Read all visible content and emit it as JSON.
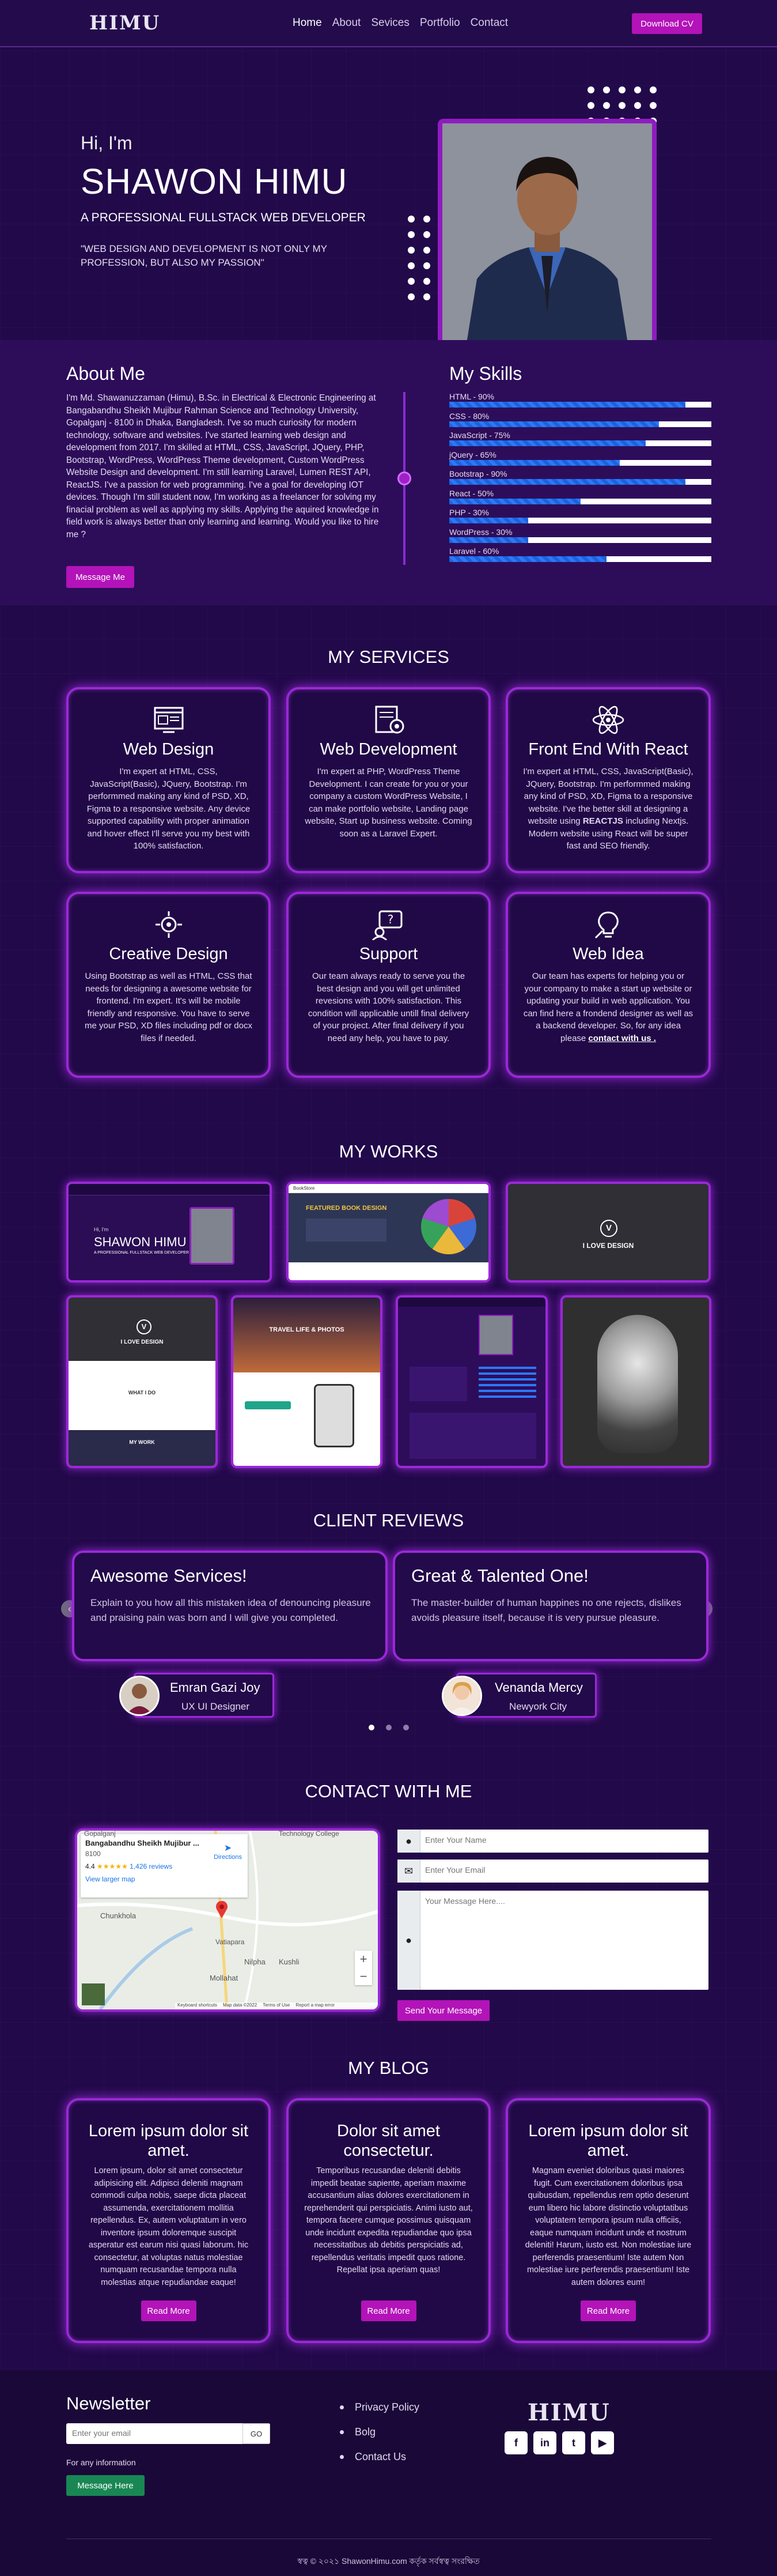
{
  "header": {
    "logo": "HIMU",
    "nav": [
      "Home",
      "About",
      "Sevices",
      "Portfolio",
      "Contact"
    ],
    "download_cv": "Download CV"
  },
  "hero": {
    "greeting": "Hi, I'm",
    "name": "SHAWON HIMU",
    "title": "A PROFESSIONAL FULLSTACK WEB DEVELOPER",
    "quote": "\"WEB DESIGN AND DEVELOPMENT IS NOT ONLY MY PROFESSION, BUT ALSO MY PASSION\""
  },
  "about": {
    "heading": "About Me",
    "text": "I'm Md. Shawanuzzaman (Himu), B.Sc. in Electrical & Electronic Engineering at Bangabandhu Sheikh Mujibur Rahman Science and Technology University, Gopalganj - 8100 in Dhaka, Bangladesh. I've so much curiosity for modern technology, software and websites. I've started learning web design and development from 2017. I'm skilled at HTML, CSS, JavaScript, JQuery, PHP, Bootstrap, WordPress, WordPress Theme development, Custom WordPress Website Design and development. I'm still learning Laravel, Lumen REST API, ReactJS. I've a passion for web programming. I've a goal for developing IOT devices. Though I'm still student now, I'm working as a freelancer for solving my finacial problem as well as applying my skills. Applying the aquired knowledge in field work is always better than only learning and learning. Would you like to hire me ?",
    "button": "Message Me"
  },
  "skills": {
    "heading": "My Skills",
    "items": [
      {
        "label": "HTML - 90%",
        "value": 90
      },
      {
        "label": "CSS - 80%",
        "value": 80
      },
      {
        "label": "JavaScript - 75%",
        "value": 75
      },
      {
        "label": "jQuery - 65%",
        "value": 65
      },
      {
        "label": "Bootstrap - 90%",
        "value": 90
      },
      {
        "label": "React - 50%",
        "value": 50
      },
      {
        "label": "PHP - 30%",
        "value": 30
      },
      {
        "label": "WordPress - 30%",
        "value": 30
      },
      {
        "label": "Laravel - 60%",
        "value": 60
      }
    ]
  },
  "services": {
    "heading": "MY SERVICES",
    "items": [
      {
        "icon": "web-design-icon",
        "title": "Web Design",
        "text": "I'm expert at HTML, CSS, JavaScript(Basic), JQuery, Bootstrap. I'm performmed making any kind of PSD, XD, Figma to a responsive website. Any device supported capability with proper animation and hover effect I'll serve you my best with 100% satisfaction."
      },
      {
        "icon": "web-development-icon",
        "title": "Web Development",
        "text": "I'm expert at PHP, WordPress Theme Development. I can create for you or your company a custom WordPress Website, I can make portfolio website, Landing page website, Start up business website. Coming soon as a Laravel Expert."
      },
      {
        "icon": "react-icon",
        "title": "Front End With React",
        "text_before": "I'm expert at HTML, CSS, JavaScript(Basic), JQuery, Bootstrap. I'm performmed making any kind of PSD, XD, Figma to a responsive website. I've the better skill at designing a website using ",
        "text_bold": "REACTJS",
        "text_after": " including Nextjs. Modern website using React will be super fast and SEO friendly."
      },
      {
        "icon": "creative-design-icon",
        "title": "Creative Design",
        "text": "Using Bootstrap as well as HTML, CSS that needs for designing a awesome website for frontend. I'm expert. It's will be mobile friendly and responsive. You have to serve me your PSD, XD files including pdf or docx files if needed."
      },
      {
        "icon": "support-icon",
        "title": "Support",
        "text": "Our team always ready to serve you the best design and you will get unlimited revesions with 100% satisfaction. This condition will applicable untill final delivery of your project. After final delivery if you need any help, you have to pay."
      },
      {
        "icon": "web-idea-icon",
        "title": "Web Idea",
        "text": "Our team has experts for helping you or your company to make a start up website or updating your build in web application. You can find here a frondend designer as well as a backend developer. So, for any idea please ",
        "link": "contact with us ."
      }
    ]
  },
  "works": {
    "heading": "MY WORKS",
    "thumb1": {
      "name": "SHAWON HIMU",
      "greet": "Hi, I'm",
      "title": "A PROFESSIONAL FULLSTACK WEB DEVELOPER"
    },
    "thumb2": {
      "brand": "BookStore",
      "headline": "FEATURED BOOK DESIGN"
    },
    "thumb3": {
      "text": "I LOVE DESIGN"
    },
    "thumb4": {
      "text": "I LOVE DESIGN",
      "section": "WHAT I DO",
      "footer": "MY WORK"
    },
    "thumb5": {
      "headline": "TRAVEL LIFE & PHOTOS"
    }
  },
  "reviews": {
    "heading": "CLIENT REVIEWS",
    "items": [
      {
        "title": "Awesome Services!",
        "text": "Explain to you how all this mistaken idea of denouncing pleasure and praising pain was born and I will give you completed.",
        "name": "Emran Gazi Joy",
        "role": "UX UI Designer"
      },
      {
        "title": "Great & Talented One!",
        "text": "The master-builder of human happines no one rejects, dislikes avoids pleasure itself, because it is very pursue pleasure.",
        "name": "Venanda Mercy",
        "role": "Newyork City"
      }
    ]
  },
  "contact": {
    "heading": "CONTACT WITH ME",
    "map": {
      "place": "Bangabandhu Sheikh Mujibur ...",
      "code": "8100",
      "rating": "4.4",
      "reviews": "1,426 reviews",
      "directions": "Directions",
      "larger": "View larger map",
      "labels": [
        "Gopalganj",
        "Technology College",
        "Chunkhola",
        "Vatiapara",
        "Nilpha",
        "Kushli",
        "Mollahat"
      ],
      "footer": [
        "Keyboard shortcuts",
        "Map data ©2022",
        "Terms of Use",
        "Report a map error"
      ]
    },
    "name_placeholder": "Enter Your Name",
    "email_placeholder": "Enter Your Email",
    "message_placeholder": "Your Message Here....",
    "send": "Send Your Message"
  },
  "blog": {
    "heading": "MY BLOG",
    "items": [
      {
        "title": "Lorem ipsum dolor sit amet.",
        "text": "Lorem ipsum, dolor sit amet consectetur adipisicing elit. Adipisci deleniti magnam commodi culpa nobis, saepe dicta placeat assumenda, exercitationem mollitia repellendus. Ex, autem voluptatum in vero inventore ipsum doloremque suscipit asperatur est earum nisi quasi laborum. hic consectetur, at voluptas natus molestiae numquam recusandae tempora nulla molestias atque repudiandae eaque!",
        "button": "Read More"
      },
      {
        "title": "Dolor sit amet consectetur.",
        "text": "Temporibus recusandae deleniti debitis impedit beatae sapiente, aperiam maxime accusantium alias dolores exercitationem in reprehenderit qui perspiciatis. Animi iusto aut, tempora facere cumque possimus quisquam unde incidunt expedita repudiandae quo ipsa necessitatibus ab debitis perspiciatis ad, repellendus veritatis impedit quos ratione. Repellat ipsa aperiam quas!",
        "button": "Read More"
      },
      {
        "title": "Lorem ipsum dolor sit amet.",
        "text": "Magnam eveniet doloribus quasi maiores fugit. Cum exercitationem doloribus ipsa quibusdam, repellendus rem optio deserunt eum libero hic labore distinctio voluptatibus voluptatem tempora ipsum nulla officiis, eaque numquam incidunt unde et nostrum deleniti! Harum, iusto est. Non molestiae iure perferendis praesentium! Iste autem Non molestiae iure perferendis praesentium! Iste autem dolores eum!",
        "button": "Read More"
      }
    ]
  },
  "footer": {
    "newsletter": "Newsletter",
    "email_placeholder": "Enter your email",
    "go": "GO",
    "info": "For any information",
    "message_here": "Message Here",
    "links": [
      "Privacy Policy",
      "Bolg",
      "Contact Us"
    ],
    "logo": "HIMU",
    "social": [
      "f",
      "in",
      "t",
      "▶"
    ],
    "copyright": "স্বত্ব © ২০২১ ShawonHimu.com কর্তৃক সর্বস্বত্ব সংরক্ষিত"
  },
  "colors": {
    "accent": "#b313b8",
    "border_glow": "#9b28d8",
    "background": "#22094a",
    "bar_fill": "#2b78ff",
    "green": "#198754"
  }
}
